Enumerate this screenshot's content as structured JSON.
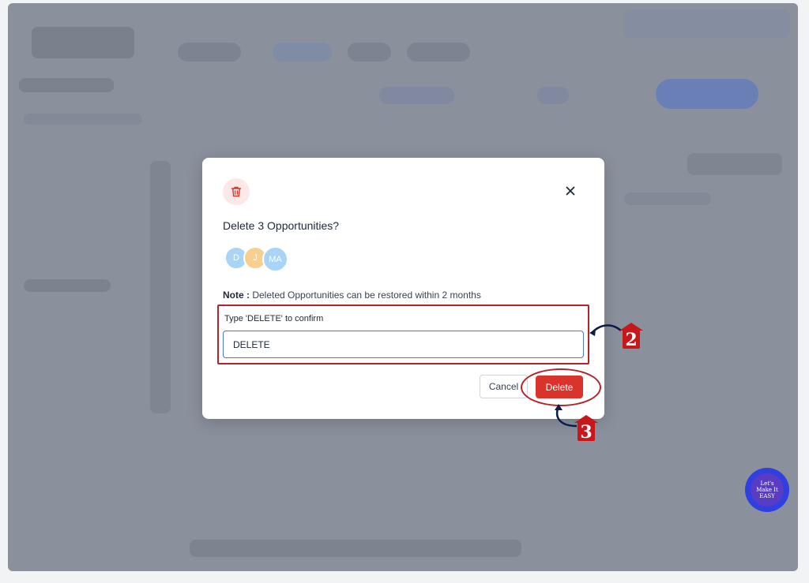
{
  "dialog": {
    "title": "Delete 3 Opportunities?",
    "avatars": [
      {
        "initials": "D",
        "color": "#a9d4f5"
      },
      {
        "initials": "J",
        "color": "#f7cf8f"
      },
      {
        "initials": "MA",
        "color": "#a9d4f5"
      }
    ],
    "note_label": "Note :",
    "note_text": "Deleted Opportunities can be restored within 2 months",
    "confirm_label": "Type 'DELETE' to confirm",
    "confirm_value": "DELETE",
    "cancel_label": "Cancel",
    "delete_label": "Delete"
  },
  "annotations": {
    "step_2": "2",
    "step_3": "3"
  },
  "watermark": {
    "text": "Let's Make It EASY"
  },
  "colors": {
    "danger": "#d9342b",
    "focus": "#4a78c9",
    "annotation": "#b4232b"
  }
}
